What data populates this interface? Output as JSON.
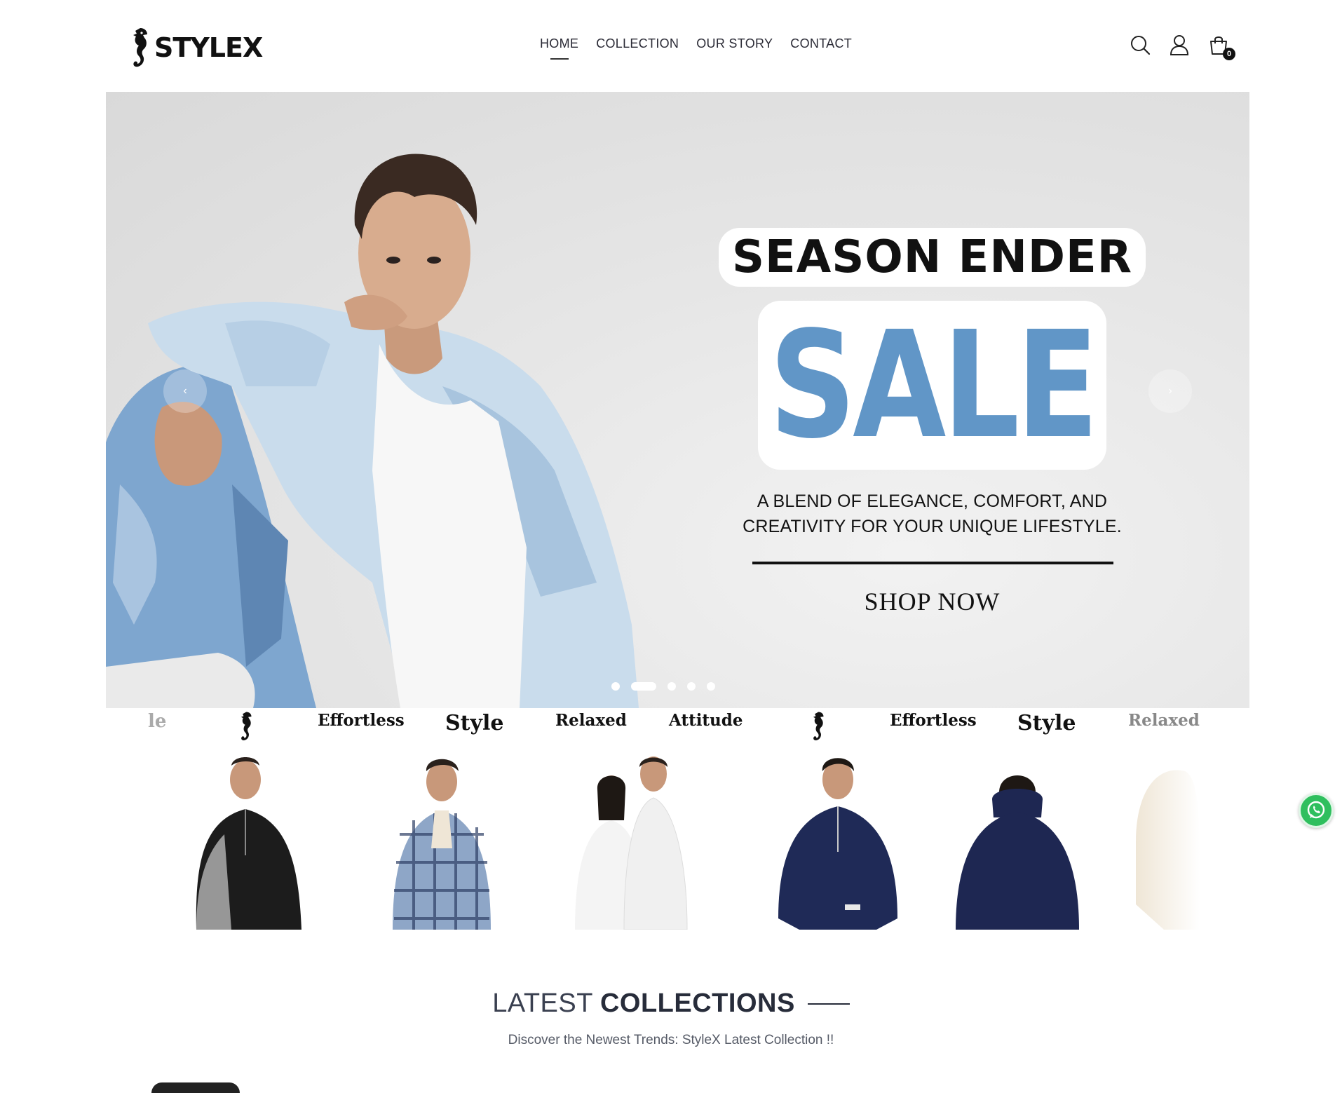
{
  "brand": {
    "name": "STYLEX",
    "logo_icon": "seahorse-icon"
  },
  "nav": [
    {
      "label": "HOME",
      "active": true
    },
    {
      "label": "COLLECTION",
      "active": false
    },
    {
      "label": "OUR STORY",
      "active": false
    },
    {
      "label": "CONTACT",
      "active": false
    }
  ],
  "header_icons": {
    "search": "search-icon",
    "account": "user-icon",
    "cart": "bag-icon",
    "cart_count": "0"
  },
  "hero": {
    "headline": "SEASON ENDER",
    "sale": "SALE",
    "tagline_line1": "A BLEND OF ELEGANCE, COMFORT, AND",
    "tagline_line2": "CREATIVITY FOR YOUR UNIQUE LIFESTYLE.",
    "cta": "SHOP NOW",
    "prev_arrow": "‹",
    "next_arrow": "›",
    "slide_count": 5,
    "active_slide": 2,
    "colors": {
      "sale": "#6196c7",
      "background": "#e6e6e6"
    }
  },
  "marquee": [
    "le",
    "Effortless",
    "Style",
    "Relaxed",
    "Attitude",
    "Effortless",
    "Style",
    "Relaxed"
  ],
  "products": [
    {
      "name": "black-half-zip-sweatshirt",
      "color": "#1c1c1c"
    },
    {
      "name": "plaid-sherpa-jacket",
      "color": "#8ea6c7"
    },
    {
      "name": "white-couple-hoodies",
      "color": "#f3f3f3"
    },
    {
      "name": "navy-half-zip-sweatshirt",
      "color": "#1f2a57"
    },
    {
      "name": "navy-hoodie",
      "color": "#1e2752"
    },
    {
      "name": "cream-hoodie",
      "color": "#efe6d6"
    }
  ],
  "whatsapp": {
    "icon": "whatsapp-icon",
    "color": "#2fbf5e"
  },
  "latest": {
    "title_light": "LATEST",
    "title_bold": "COLLECTIONS",
    "subtitle": "Discover the Newest Trends: StyleX Latest Collection !!"
  }
}
